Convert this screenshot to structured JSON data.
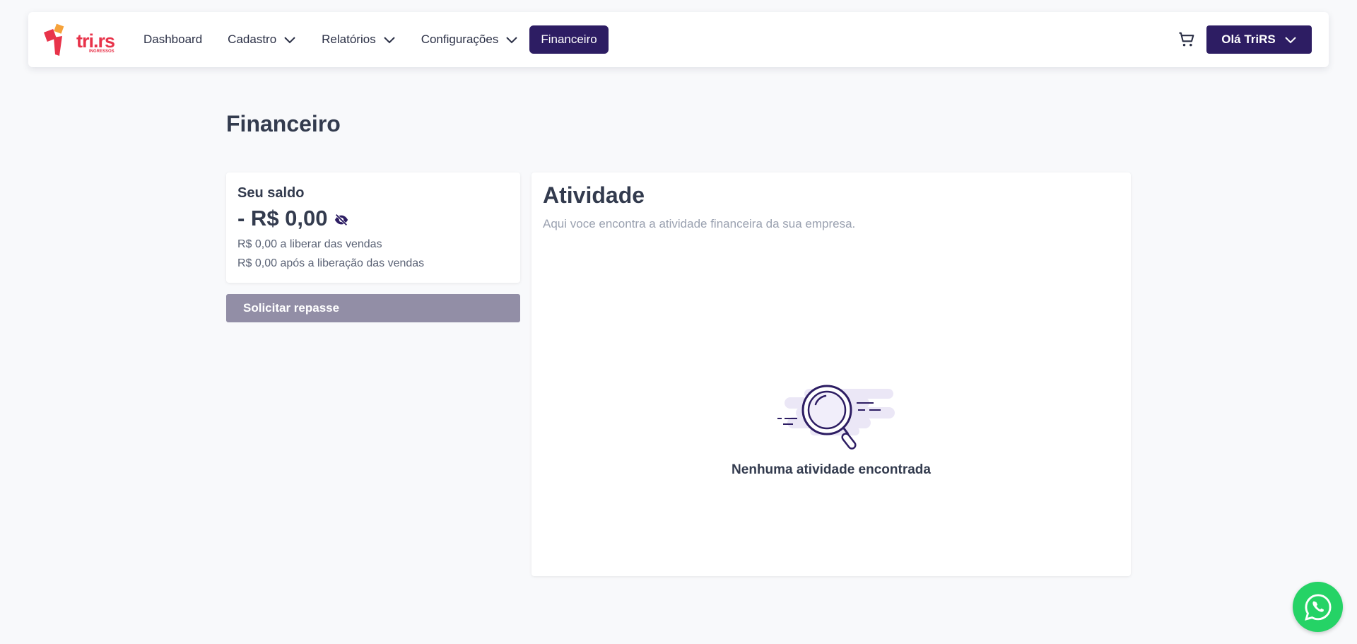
{
  "brand": {
    "logo_text": "tri.rs",
    "logo_sub": "INGRESSOS",
    "logo_color": "#e8334a"
  },
  "nav": {
    "items": [
      {
        "label": "Dashboard",
        "dropdown": false
      },
      {
        "label": "Cadastro",
        "dropdown": true
      },
      {
        "label": "Relatórios",
        "dropdown": true
      },
      {
        "label": "Configurações",
        "dropdown": true
      },
      {
        "label": "Financeiro",
        "dropdown": false,
        "active": true
      }
    ],
    "cart_icon": "cart-icon",
    "user_label": "Olá TriRS"
  },
  "page": {
    "title": "Financeiro"
  },
  "balance": {
    "label": "Seu saldo",
    "value": "- R$ 0,00",
    "to_release": "R$ 0,00 a liberar das vendas",
    "after_release": "R$ 0,00 após a liberação das vendas",
    "visibility_icon": "eye-off-icon"
  },
  "repasse_button": "Solicitar repasse",
  "activity": {
    "title": "Atividade",
    "subtitle": "Aqui voce encontra a atividade financeira da sua empresa.",
    "empty_icon": "magnifier-illustration",
    "empty_text": "Nenhuma atividade encontrada"
  },
  "colors": {
    "primary": "#2d1d63",
    "disabled_button": "#928ea6",
    "whatsapp": "#25d366",
    "background": "#f8f9fb"
  },
  "floating": {
    "whatsapp_icon": "whatsapp-icon"
  }
}
